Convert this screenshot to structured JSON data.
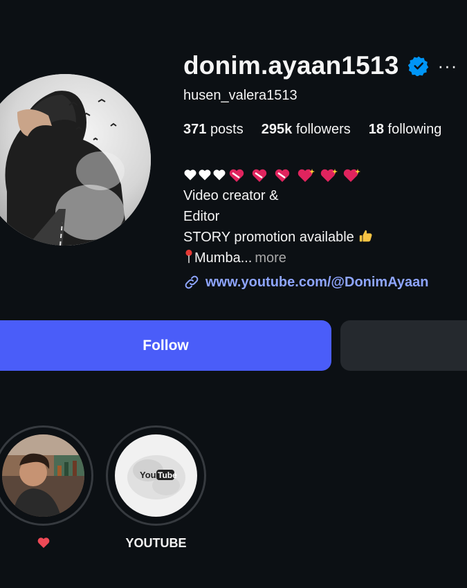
{
  "profile": {
    "username": "donim.ayaan1513",
    "full_name": "husen_valera1513",
    "verified": true,
    "more_glyph": "···"
  },
  "stats": {
    "posts_count": "371",
    "posts_label": "posts",
    "followers_count": "295k",
    "followers_label": "followers",
    "following_count": "18",
    "following_label": "following"
  },
  "bio": {
    "emoji_icons": [
      "white-heart",
      "white-heart",
      "white-heart",
      "mending-heart",
      "mending-heart",
      "mending-heart",
      "sparkling-heart",
      "sparkling-heart",
      "sparkling-heart"
    ],
    "line1": "Video creator &",
    "line2": "Editor",
    "line3": "STORY promotion available",
    "line3_emoji": "thumbs-up",
    "line4_emoji": "round-pushpin",
    "line4": "Mumba...",
    "more_label": "more",
    "link": "www.youtube.com/@DonimAyaan"
  },
  "buttons": {
    "follow_label": "Follow"
  },
  "highlights": [
    {
      "title": "",
      "title_emoji": "red-heart",
      "icon": "photo-cover"
    },
    {
      "title": "YOUTUBE",
      "icon": "youtube-logo",
      "logo_text_left": "You",
      "logo_text_right": "Tube"
    }
  ],
  "colors": {
    "background": "#0c1014",
    "follow_button": "#4a5df9",
    "secondary_button": "#25292e",
    "link": "#8ea5ff",
    "verified_badge": "#0095f6",
    "muted_text": "#a8a8a8"
  }
}
